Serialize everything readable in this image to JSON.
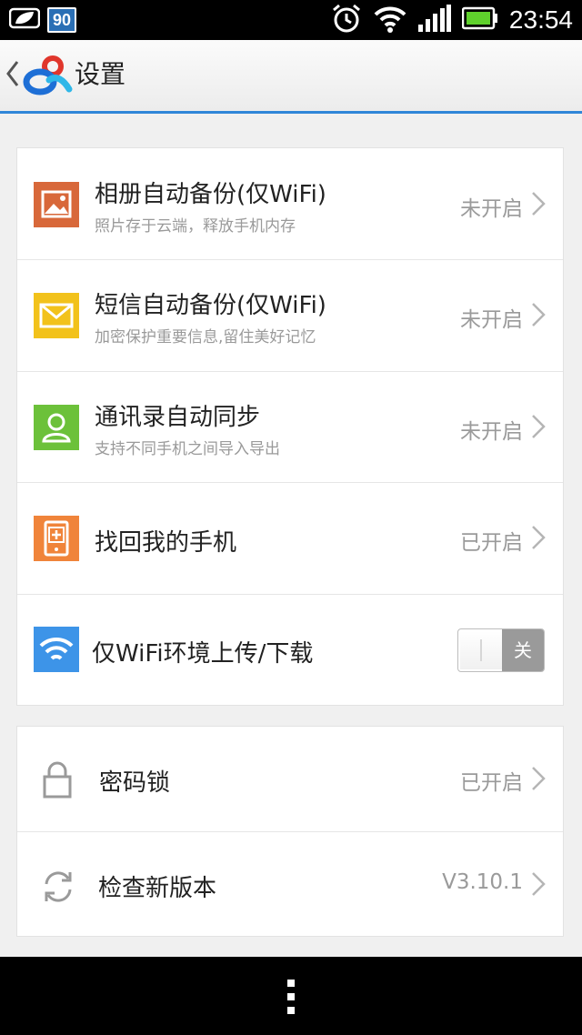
{
  "status_bar": {
    "battery_saver_badge": "90",
    "clock": "23:54"
  },
  "header": {
    "title": "设置"
  },
  "settings_card": {
    "rows": [
      {
        "title": "相册自动备份(仅WiFi)",
        "subtitle": "照片存于云端，释放手机内存",
        "status": "未开启",
        "icon": "photo-icon",
        "icon_color": "#d8683a"
      },
      {
        "title": "短信自动备份(仅WiFi)",
        "subtitle": "加密保护重要信息,留住美好记忆",
        "status": "未开启",
        "icon": "envelope-icon",
        "icon_color": "#f2c21b"
      },
      {
        "title": "通讯录自动同步",
        "subtitle": "支持不同手机之间导入导出",
        "status": "未开启",
        "icon": "contact-icon",
        "icon_color": "#6cc13a"
      },
      {
        "title": "找回我的手机",
        "status": "已开启",
        "icon": "find-phone-icon",
        "icon_color": "#f0843a"
      },
      {
        "title": "仅WiFi环境上传/下载",
        "toggle_label": "关",
        "toggle_on": false,
        "icon": "wifi-icon",
        "icon_color": "#3d94e8"
      }
    ]
  },
  "security_card": {
    "rows": [
      {
        "title": "密码锁",
        "status": "已开启",
        "icon": "lock-icon"
      },
      {
        "title": "检查新版本",
        "status": "V3.10.1",
        "icon": "refresh-icon"
      }
    ]
  }
}
